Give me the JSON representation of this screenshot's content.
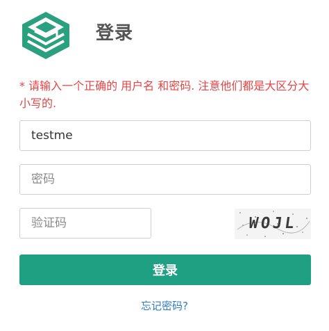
{
  "header": {
    "logo_icon": "stacked-layers-logo-icon",
    "title": "登录"
  },
  "error_message": "* 请输入一个正确的 用户名 和密码. 注意他们都是大区分大小写的.",
  "form": {
    "username": {
      "value": "testme",
      "placeholder": ""
    },
    "password": {
      "value": "",
      "placeholder": "密码"
    },
    "captcha": {
      "value": "",
      "placeholder": "验证码",
      "image_text": "WOJL"
    },
    "submit_label": "登录",
    "forgot_link": "忘记密码?"
  },
  "colors": {
    "accent": "#1fa082",
    "error": "#e54545",
    "link": "#2c7cc8",
    "logo": "#2aa07e"
  }
}
